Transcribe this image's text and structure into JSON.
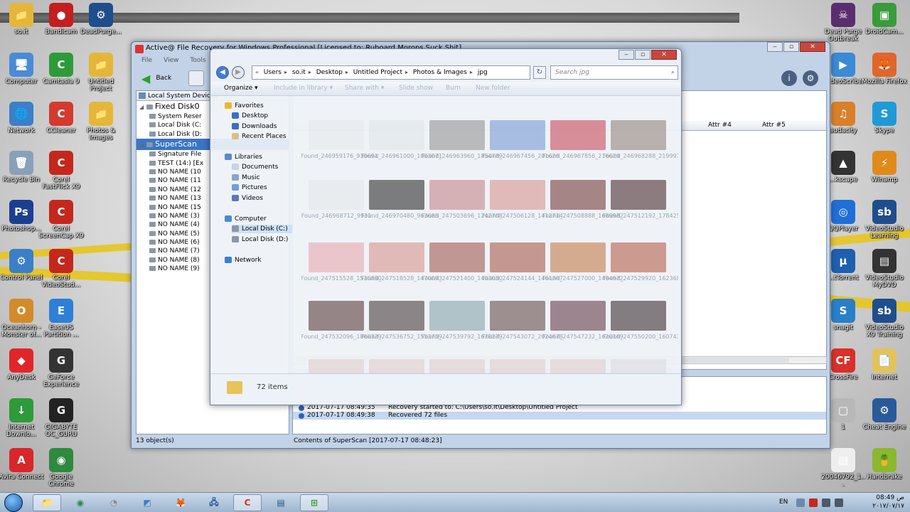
{
  "desktop": {
    "left_icons": [
      {
        "label": "so.it",
        "color": "#e4b63a",
        "glyph": "📁"
      },
      {
        "label": "Bandicam",
        "color": "#c41e1e",
        "glyph": "●"
      },
      {
        "label": "DeadPurge...",
        "color": "#1f4e8c",
        "glyph": "⚙"
      },
      {
        "label": "Computer",
        "color": "#4a8bd6",
        "glyph": "🖥"
      },
      {
        "label": "Camtasia 9",
        "color": "#2e9b3a",
        "glyph": "C"
      },
      {
        "label": "Untitled Project",
        "color": "#e4b63a",
        "glyph": "📁"
      },
      {
        "label": "Network",
        "color": "#3b7fc8",
        "glyph": "🌐"
      },
      {
        "label": "CCleaner",
        "color": "#d33b2e",
        "glyph": "C"
      },
      {
        "label": "Photos & Images",
        "color": "#e4b63a",
        "glyph": "📁"
      },
      {
        "label": "Recycle Bin",
        "color": "#8aa0b8",
        "glyph": "🗑"
      },
      {
        "label": "Corel FastFlick X9",
        "color": "#c4281c",
        "glyph": "C"
      },
      {
        "label": "Photoshop...",
        "color": "#1b3f8f",
        "glyph": "Ps"
      },
      {
        "label": "Corel ScreenCap X9",
        "color": "#c4281c",
        "glyph": "C"
      },
      {
        "label": "Control Panel",
        "color": "#3b7fc8",
        "glyph": "⚙"
      },
      {
        "label": "Corel VideoStud...",
        "color": "#c4281c",
        "glyph": "C"
      },
      {
        "label": "Oceanhorn - Monster of...",
        "color": "#d38b2a",
        "glyph": "O"
      },
      {
        "label": "EaseUS Partition ...",
        "color": "#2e7fd6",
        "glyph": "E"
      },
      {
        "label": "AnyDesk",
        "color": "#e0262a",
        "glyph": "◆"
      },
      {
        "label": "GeForce Experience",
        "color": "#333333",
        "glyph": "G"
      },
      {
        "label": "Internet Downlo...",
        "color": "#2e9b3a",
        "glyph": "↓"
      },
      {
        "label": "GIGABYTE OC_GURU",
        "color": "#222222",
        "glyph": "G"
      },
      {
        "label": "Avira Connect",
        "color": "#d8262a",
        "glyph": "A"
      },
      {
        "label": "Google Chrome",
        "color": "#2d8a3e",
        "glyph": "◉"
      }
    ],
    "right_icons": [
      {
        "label": "Dead Purge Outbreak",
        "color": "#5a2e6e",
        "glyph": "☠"
      },
      {
        "label": "DroidCam...",
        "color": "#3a9b3a",
        "glyph": "▣"
      },
      {
        "label": "...deoScribe",
        "color": "#3b8ad6",
        "glyph": "▶"
      },
      {
        "label": "Mozilla Firefox",
        "color": "#e0662a",
        "glyph": "🦊"
      },
      {
        "label": "audacity",
        "color": "#d8802a",
        "glyph": "♫"
      },
      {
        "label": "Skype",
        "color": "#1f9ad6",
        "glyph": "S"
      },
      {
        "label": "...kscape",
        "color": "#333333",
        "glyph": "▲"
      },
      {
        "label": "Winamp",
        "color": "#e08a1a",
        "glyph": "⚡"
      },
      {
        "label": "QQPlayer",
        "color": "#1f6fd6",
        "glyph": "◎"
      },
      {
        "label": "VideoStudio Learning",
        "color": "#1f4e8c",
        "glyph": "sb"
      },
      {
        "label": "...tTorrent",
        "color": "#1f5fb0",
        "glyph": "μ"
      },
      {
        "label": "VideoStudio MyDVD",
        "color": "#333333",
        "glyph": "▤"
      },
      {
        "label": "snagit",
        "color": "#2a7fc8",
        "glyph": "S"
      },
      {
        "label": "VideoStudio X9 Training",
        "color": "#1f4e8c",
        "glyph": "sb"
      },
      {
        "label": "CrossFire",
        "color": "#d8302a",
        "glyph": "CF"
      },
      {
        "label": "Internet",
        "color": "#e4c25a",
        "glyph": "📄"
      },
      {
        "label": "1",
        "color": "#b8b8b8",
        "glyph": "▢"
      },
      {
        "label": "Cheat Engine",
        "color": "#2a5a9b",
        "glyph": "⚙"
      },
      {
        "label": "20046792_1...",
        "color": "#eeeeee",
        "glyph": "▤"
      },
      {
        "label": "Handbrake",
        "color": "#8ab82e",
        "glyph": "🍍"
      }
    ]
  },
  "app": {
    "title": "Active@ File Recovery for Windows Professional [Licensed to: Ruboard Morons Suck Shit]",
    "menu": [
      "File",
      "View",
      "Tools"
    ],
    "back_label": "Back",
    "tree_header": "Local System Devices",
    "tree": [
      {
        "label": "Fixed Disk0",
        "level": 0,
        "big": true,
        "exp": "◢"
      },
      {
        "label": "System Reser",
        "level": 1
      },
      {
        "label": "Local Disk (C:",
        "level": 1
      },
      {
        "label": "Local Disk (D:",
        "level": 1
      },
      {
        "label": "SuperScan",
        "level": 0,
        "big": true,
        "exp": "◢",
        "selected": true
      },
      {
        "label": "Signature File",
        "level": 1
      },
      {
        "label": "TEST (14:) [Ex",
        "level": 1
      },
      {
        "label": "NO NAME (10",
        "level": 1
      },
      {
        "label": "NO NAME (11",
        "level": 1
      },
      {
        "label": "NO NAME (12",
        "level": 1
      },
      {
        "label": "NO NAME (13",
        "level": 1
      },
      {
        "label": "NO NAME (15",
        "level": 1
      },
      {
        "label": "NO NAME (3)",
        "level": 1
      },
      {
        "label": "NO NAME (4)",
        "level": 1
      },
      {
        "label": "NO NAME (5)",
        "level": 1
      },
      {
        "label": "NO NAME (6)",
        "level": 1
      },
      {
        "label": "NO NAME (7)",
        "level": 1
      },
      {
        "label": "NO NAME (8)",
        "level": 1
      },
      {
        "label": "NO NAME (9)",
        "level": 1
      }
    ],
    "columns": {
      "attr4": "Attr #4",
      "attr5": "Attr #5"
    },
    "log": [
      {
        "time": "2017-07-17 08:49:35",
        "message": "Recovery started to: C:\\Users\\so.it\\Desktop\\Untitled Project"
      },
      {
        "time": "2017-07-17 08:49:38",
        "message": "Recovered 72 files",
        "selected": true
      }
    ],
    "status_left": "13 object(s)",
    "status_right": "Contents of SuperScan [2017-07-17 08:48:23]"
  },
  "explorer": {
    "breadcrumb": [
      "Users",
      "so.it",
      "Desktop",
      "Untitled Project",
      "Photos & Images",
      "jpg"
    ],
    "search_placeholder": "Search jpg",
    "commands": {
      "organize": "Organize ▾",
      "include": "Include in library ▾",
      "share": "Share with ▾",
      "slideshow": "Slide show",
      "burn": "Burn",
      "newfolder": "New folder"
    },
    "nav": {
      "favorites": "Favorites",
      "desktop": "Desktop",
      "downloads": "Downloads",
      "recent": "Recent Places",
      "libraries": "Libraries",
      "documents": "Documents",
      "music": "Music",
      "pictures": "Pictures",
      "videos": "Videos",
      "computer": "Computer",
      "disk_c": "Local Disk (C:)",
      "disk_d": "Local Disk (D:)",
      "network": "Network"
    },
    "files": [
      {
        "name": "Found_246959176_930691",
        "color": "#e6e8ea"
      },
      {
        "name": "Found_246961000_1003071",
        "color": "#dfe3e8"
      },
      {
        "name": "Found_246963960_1854789",
        "color": "#8a8a8a"
      },
      {
        "name": "Found_246967456_201626",
        "color": "#6e8fcf"
      },
      {
        "name": "Found_246967856_216629",
        "color": "#c23a4a"
      },
      {
        "name": "Found_246968288_219997",
        "color": "#8a7a70"
      },
      {
        "name": "Found_246968712_9931",
        "color": "#e2e5e8"
      },
      {
        "name": "Found_246970480_963685",
        "color": "#1a1a1a"
      },
      {
        "name": "Found_247503696_1242708",
        "color": "#c07a80"
      },
      {
        "name": "Found_247506128_1412714",
        "color": "#d48a84"
      },
      {
        "name": "Found_247508888_1689982",
        "color": "#6a2a2a"
      },
      {
        "name": "Found_247512192_1784259",
        "color": "#3a1a1e"
      },
      {
        "name": "Found_247515528_1535890",
        "color": "#e6a0a6"
      },
      {
        "name": "Found_247518528_1470093",
        "color": "#d48a80"
      },
      {
        "name": "Found_247521400_1403050",
        "color": "#9a4a40"
      },
      {
        "name": "Found_247524144_1461367",
        "color": "#a04a3a"
      },
      {
        "name": "Found_247527000_1494972",
        "color": "#c0703a"
      },
      {
        "name": "Found_247529920_1623689",
        "color": "#b0503a"
      },
      {
        "name": "Found_247532096_1868329",
        "color": "#4a2a2a"
      },
      {
        "name": "Found_247536752_1553759",
        "color": "#3a2a2a"
      },
      {
        "name": "Found_247539792_1678279",
        "color": "#7a9aa0"
      },
      {
        "name": "Found_247543072_2024678",
        "color": "#5a3a3a"
      },
      {
        "name": "Found_247547232_1620169",
        "color": "#5a2a3a"
      },
      {
        "name": "Found_247550200_1607431",
        "color": "#2a1a1e"
      },
      {
        "name": "",
        "color": "#e0c8c8"
      },
      {
        "name": "",
        "color": "#e0c8c8"
      },
      {
        "name": "",
        "color": "#e0c8c8"
      },
      {
        "name": "",
        "color": "#e0c8c8"
      },
      {
        "name": "",
        "color": "#e0c8c8"
      },
      {
        "name": "",
        "color": "#d8d8e0"
      }
    ],
    "item_count": "72 items"
  },
  "taskbar": {
    "items": [
      {
        "name": "taskbar-explorer",
        "glyph": "📁",
        "color": "#e4b63a",
        "active": true
      },
      {
        "name": "taskbar-chrome",
        "glyph": "◉",
        "color": "#2d8a3e"
      },
      {
        "name": "taskbar-speedtest",
        "glyph": "◔",
        "color": "#888888"
      },
      {
        "name": "taskbar-app",
        "glyph": "◩",
        "color": "#3b7fc8"
      },
      {
        "name": "taskbar-firefox",
        "glyph": "🦊",
        "color": "#e0662a"
      },
      {
        "name": "taskbar-network",
        "glyph": "🖧",
        "color": "#2a5a9b"
      },
      {
        "name": "taskbar-camtasia",
        "glyph": "C",
        "color": "#d8302a",
        "active": true
      },
      {
        "name": "taskbar-bandicam",
        "glyph": "▤",
        "color": "#1f4e8c"
      },
      {
        "name": "taskbar-recovery",
        "glyph": "⊞",
        "color": "#3a9b3a",
        "active": true
      }
    ],
    "lang": "EN",
    "time": "08:49 ص",
    "date": "٢٠١٧/٠٧/١٧"
  }
}
